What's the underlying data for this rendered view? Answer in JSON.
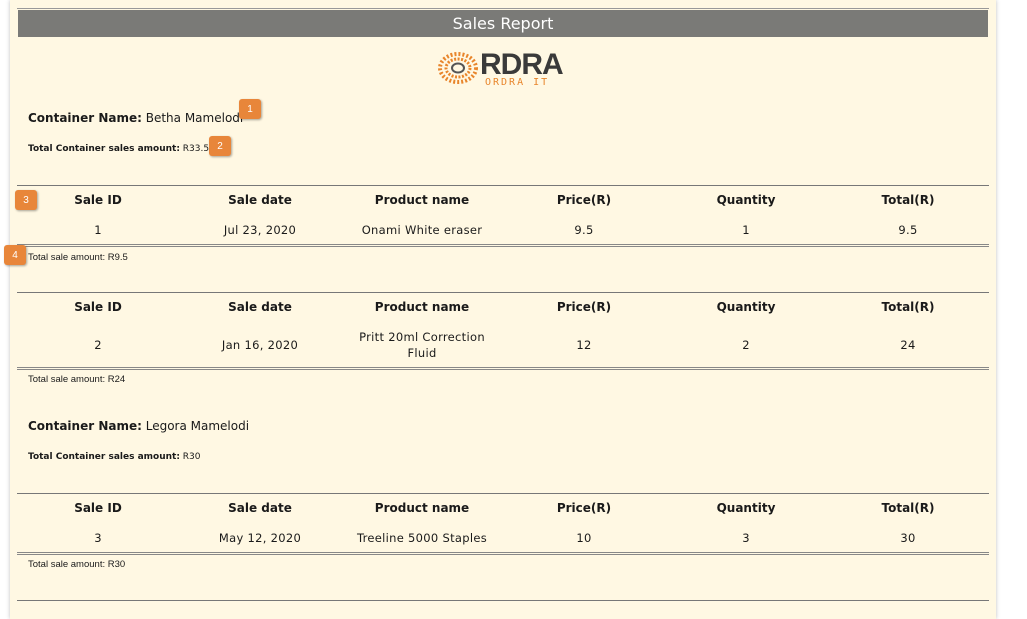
{
  "report": {
    "title": "Sales Report",
    "logo": {
      "text": "RDRA",
      "sub": "ORDRA IT"
    }
  },
  "labels": {
    "container_name": "Container Name:",
    "container_total": "Total Container sales amount:"
  },
  "columns": [
    "Sale ID",
    "Sale date",
    "Product name",
    "Price(R)",
    "Quantity",
    "Total(R)"
  ],
  "containers": [
    {
      "name": "Betha Mamelodi",
      "total": "R33.5",
      "sales": [
        {
          "id": "1",
          "date": "Jul 23, 2020",
          "product": "Onami White eraser",
          "price": "9.5",
          "quantity": "1",
          "total": "9.5",
          "total_label": "Total sale amount: R9.5"
        },
        {
          "id": "2",
          "date": "Jan 16, 2020",
          "product": "Pritt 20ml Correction Fluid",
          "price": "12",
          "quantity": "2",
          "total": "24",
          "total_label": "Total sale amount: R24"
        }
      ]
    },
    {
      "name": "Legora Mamelodi",
      "total": "R30",
      "sales": [
        {
          "id": "3",
          "date": "May 12, 2020",
          "product": "Treeline 5000 Staples",
          "price": "10",
          "quantity": "3",
          "total": "30",
          "total_label": "Total sale amount: R30"
        }
      ]
    }
  ],
  "badges": [
    "1",
    "2",
    "3",
    "4"
  ],
  "colors": {
    "title_bar": "#7a7a77",
    "paper": "#fff8e3",
    "badge": "#e8863a",
    "logo_orange": "#e8852b"
  }
}
